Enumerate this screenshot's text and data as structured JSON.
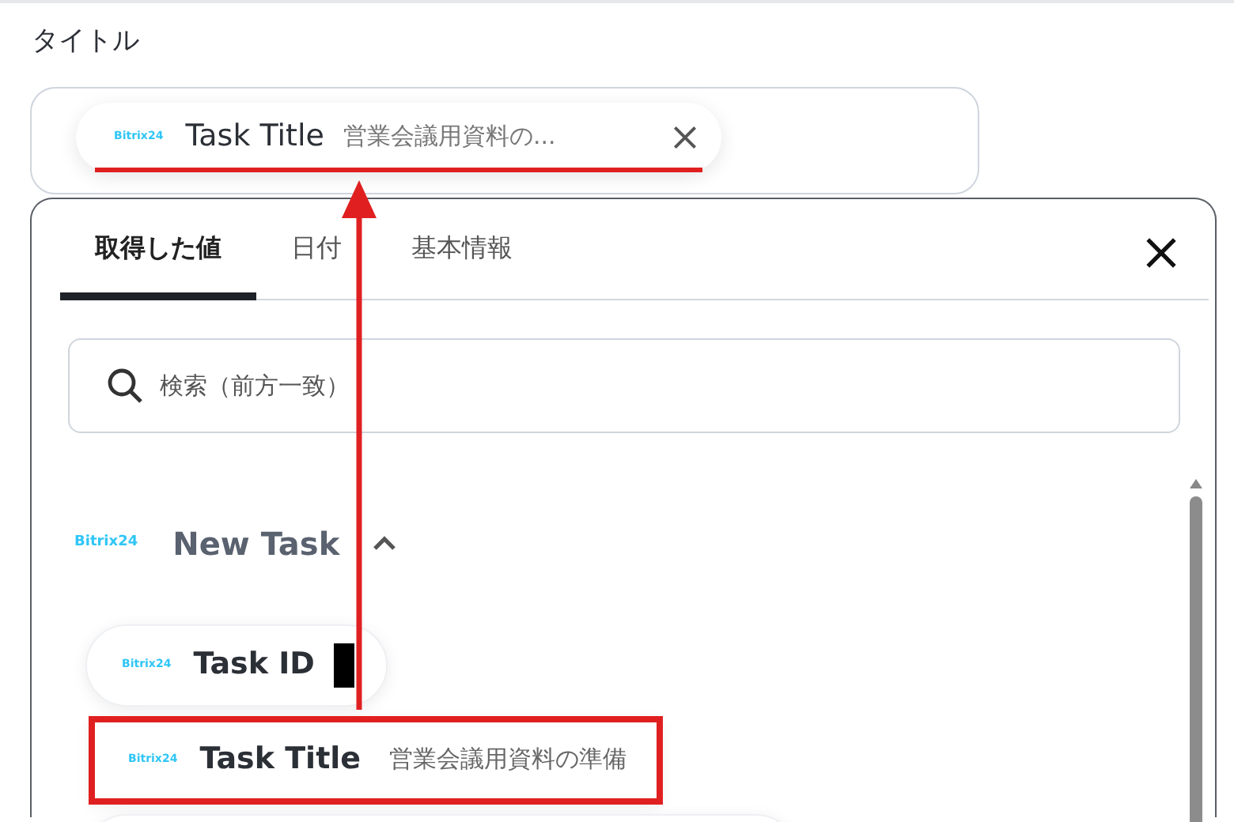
{
  "field": {
    "label": "タイトル",
    "chip": {
      "logo": "Bitrix24",
      "name": "Task Title",
      "value": "営業会議用資料の...",
      "underlined": true
    }
  },
  "panel": {
    "tabs": [
      {
        "label": "取得した値",
        "selected": true
      },
      {
        "label": "日付",
        "selected": false
      },
      {
        "label": "基本情報",
        "selected": false
      }
    ],
    "search": {
      "placeholder": "検索（前方一致）"
    },
    "groups": [
      {
        "logo": "Bitrix24",
        "title": "New Task",
        "expanded": true,
        "items": [
          {
            "logo": "Bitrix24",
            "name": "Task ID",
            "redacted": true,
            "highlighted": false
          },
          {
            "logo": "Bitrix24",
            "name": "Task Title",
            "value": "営業会議用資料の準備",
            "redacted": false,
            "highlighted": true
          },
          {
            "cut_off": true
          }
        ]
      }
    ]
  },
  "arrow": true
}
